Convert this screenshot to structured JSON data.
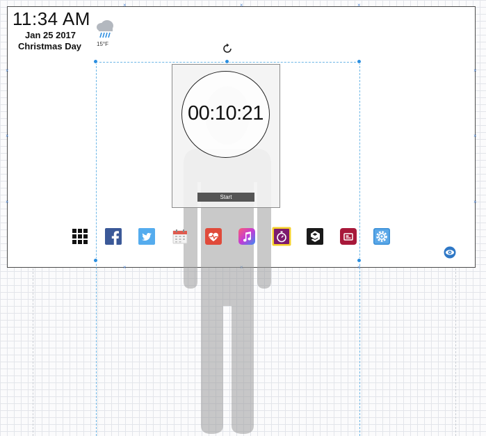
{
  "clock": {
    "time": "11:34 AM",
    "date": "Jan 25 2017",
    "holiday": "Christmas Day"
  },
  "weather": {
    "icon": "rain-cloud-icon",
    "temperature": "15°F"
  },
  "timer": {
    "readout": "00:10:21",
    "start_label": "Start"
  },
  "dock": {
    "apps": [
      {
        "name": "apps-grid-icon",
        "color": "#111111"
      },
      {
        "name": "facebook-icon",
        "color": "#3b5998"
      },
      {
        "name": "twitter-icon",
        "color": "#55acee"
      },
      {
        "name": "calendar-icon",
        "color": "#e05a4e"
      },
      {
        "name": "health-icon",
        "color": "#e04a3a"
      },
      {
        "name": "music-icon",
        "color": "#c33bd6"
      },
      {
        "name": "stopwatch-icon",
        "color": "#8b1f7a",
        "selected": true
      },
      {
        "name": "9gag-icon",
        "color": "#1a1a1a"
      },
      {
        "name": "flipboard-icon",
        "color": "#a8183a"
      },
      {
        "name": "settings-icon",
        "color": "#3a8fd6"
      }
    ]
  },
  "accent": {
    "selection": "#2b8fe0",
    "canvas_border": "#4a4a4a"
  }
}
